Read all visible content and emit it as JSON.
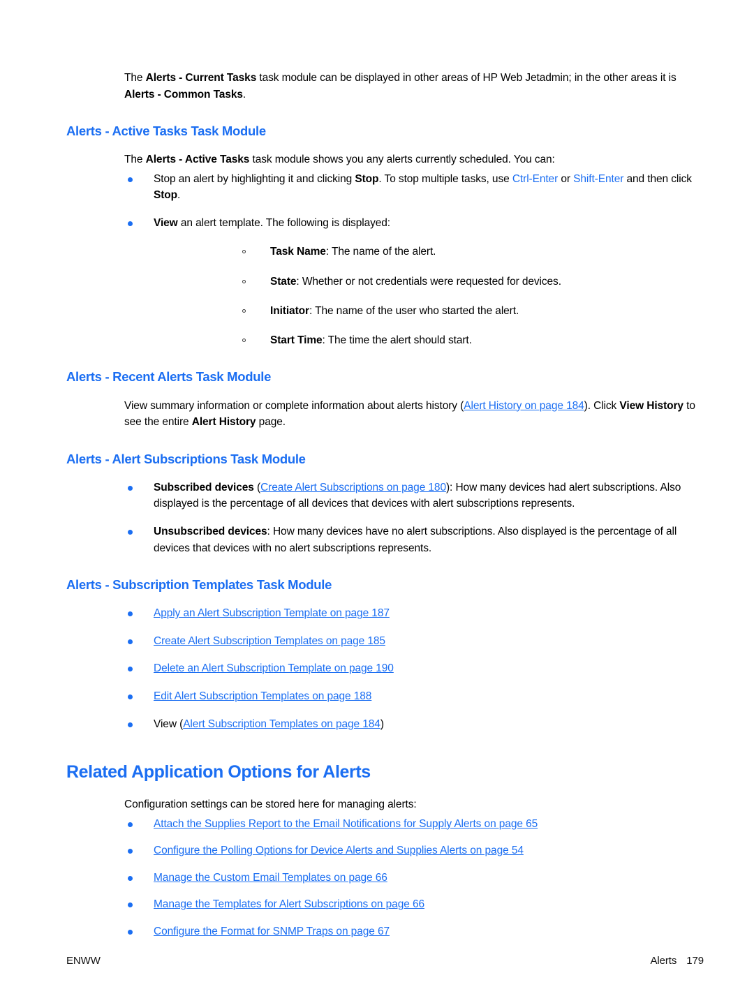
{
  "document": {
    "intro_paragraph": {
      "prefix": "The ",
      "bold_1": "Alerts - Current Tasks",
      "middle": " task module can be displayed in other areas of HP Web Jetadmin; in the other areas it is ",
      "bold_2": "Alerts - Common Tasks",
      "suffix": "."
    },
    "sections": {
      "active_tasks": {
        "heading": "Alerts - Active Tasks Task Module",
        "intro": {
          "prefix": "The ",
          "bold_1": "Alerts - Active Tasks",
          "suffix": " task module shows you any alerts currently scheduled. You can:"
        },
        "bullets": {
          "stop": {
            "part_1": "Stop an alert by highlighting it and clicking ",
            "bold_1": "Stop",
            "part_2": ". To stop multiple tasks, use ",
            "link_1": "Ctrl-Enter",
            "part_3": " or ",
            "link_2": "Shift-Enter",
            "part_4": " and then click ",
            "bold_2": "Stop",
            "part_5": "."
          },
          "view": {
            "bold_1": "View",
            "suffix": " an alert template. The following is displayed:"
          }
        },
        "subbullets": [
          {
            "term": "Task Name",
            "desc": ": The name of the alert."
          },
          {
            "term": "State",
            "desc": ": Whether or not credentials were requested for devices."
          },
          {
            "term": "Initiator",
            "desc": ": The name of the user who started the alert."
          },
          {
            "term": "Start Time",
            "desc": ": The time the alert should start."
          }
        ]
      },
      "recent_alerts": {
        "heading": "Alerts - Recent Alerts Task Module",
        "paragraph": {
          "part_1": "View summary information or complete information about alerts history (",
          "link_1": "Alert History on page 184",
          "part_2": "). Click ",
          "bold_1": "View History",
          "part_3": " to see the entire ",
          "bold_2": "Alert History",
          "part_4": " page."
        }
      },
      "alert_subscriptions": {
        "heading": "Alerts - Alert Subscriptions Task Module",
        "bullets": {
          "subscribed": {
            "bold_1": "Subscribed devices",
            "part_1": " (",
            "link_1": "Create Alert Subscriptions on page 180",
            "part_2": "): How many devices had alert subscriptions. Also displayed is the percentage of all devices that devices with alert subscriptions represents."
          },
          "unsubscribed": {
            "bold_1": "Unsubscribed devices",
            "part_1": ": How many devices have no alert subscriptions. Also displayed is the percentage of all devices that devices with no alert subscriptions represents."
          }
        }
      },
      "subscription_templates": {
        "heading": "Alerts - Subscription Templates Task Module",
        "links": [
          {
            "prefix": "",
            "link": "Apply an Alert Subscription Template on page 187",
            "suffix": ""
          },
          {
            "prefix": "",
            "link": "Create Alert Subscription Templates on page 185",
            "suffix": ""
          },
          {
            "prefix": "",
            "link": "Delete an Alert Subscription Template on page 190",
            "suffix": ""
          },
          {
            "prefix": "",
            "link": "Edit Alert Subscription Templates on page 188",
            "suffix": ""
          },
          {
            "prefix": "View (",
            "link": "Alert Subscription Templates on page 184",
            "suffix": ")"
          }
        ]
      },
      "related_options": {
        "heading": "Related Application Options for Alerts",
        "intro": "Configuration settings can be stored here for managing alerts:",
        "links": [
          "Attach the Supplies Report to the Email Notifications for Supply Alerts on page 65",
          "Configure the Polling Options for Device Alerts and Supplies Alerts on page 54",
          "Manage the Custom Email Templates on page 66",
          "Manage the Templates for Alert Subscriptions on page 66",
          "Configure the Format for SNMP Traps on page 67"
        ]
      }
    },
    "footer": {
      "left": "ENWW",
      "right_label": "Alerts",
      "right_page": "179"
    },
    "colors": {
      "heading_blue": "#1b6ef2",
      "link_blue": "#1b6ef2",
      "body_black": "#000000"
    }
  }
}
